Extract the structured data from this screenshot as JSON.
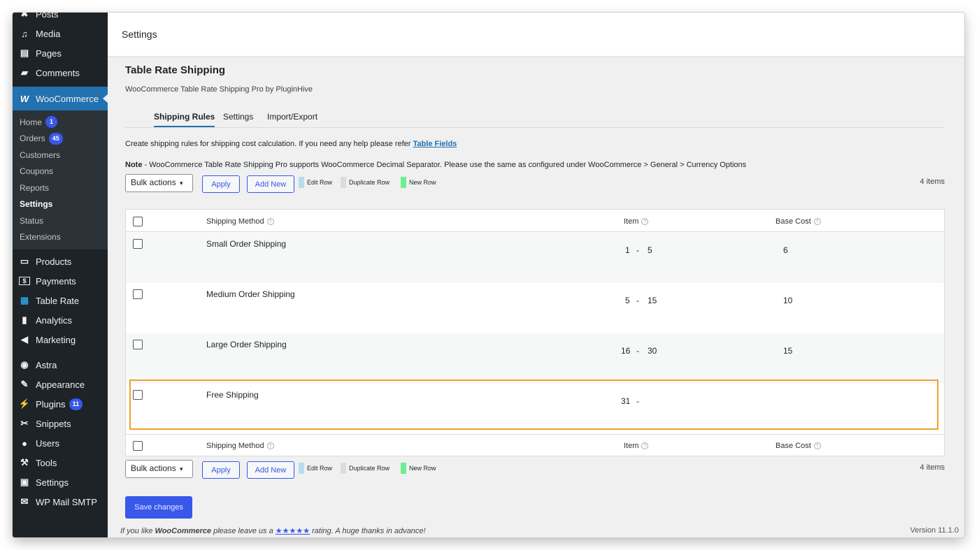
{
  "sidebar": {
    "items_top": [
      {
        "icon": "pushpin-icon",
        "glyph": "✖",
        "label": "Posts"
      },
      {
        "icon": "media-icon",
        "glyph": "♫",
        "label": "Media"
      },
      {
        "icon": "pages-icon",
        "glyph": "▤",
        "label": "Pages"
      },
      {
        "icon": "comments-icon",
        "glyph": "▰",
        "label": "Comments"
      }
    ],
    "woocommerce": {
      "icon": "woocommerce-icon",
      "glyph": "W",
      "label": "WooCommerce"
    },
    "submenu": [
      {
        "label": "Home",
        "badge": "1"
      },
      {
        "label": "Orders",
        "badge": "45"
      },
      {
        "label": "Customers"
      },
      {
        "label": "Coupons"
      },
      {
        "label": "Reports"
      },
      {
        "label": "Settings",
        "active": true
      },
      {
        "label": "Status"
      },
      {
        "label": "Extensions"
      }
    ],
    "items_mid": [
      {
        "icon": "products-icon",
        "glyph": "▭",
        "label": "Products"
      },
      {
        "icon": "payments-icon",
        "glyph": "$",
        "label": "Payments"
      },
      {
        "icon": "table-rate-icon",
        "glyph": "▦",
        "label": "Table Rate"
      },
      {
        "icon": "analytics-icon",
        "glyph": "▮",
        "label": "Analytics"
      },
      {
        "icon": "marketing-icon",
        "glyph": "◀",
        "label": "Marketing"
      }
    ],
    "items_bottom": [
      {
        "icon": "astra-icon",
        "glyph": "◉",
        "label": "Astra"
      },
      {
        "icon": "appearance-icon",
        "glyph": "✎",
        "label": "Appearance"
      },
      {
        "icon": "plugins-icon",
        "glyph": "⚡",
        "label": "Plugins",
        "badge": "11"
      },
      {
        "icon": "snippets-icon",
        "glyph": "✂",
        "label": "Snippets"
      },
      {
        "icon": "users-icon",
        "glyph": "●",
        "label": "Users"
      },
      {
        "icon": "tools-icon",
        "glyph": "⚒",
        "label": "Tools"
      },
      {
        "icon": "settings-icon",
        "glyph": "▣",
        "label": "Settings"
      },
      {
        "icon": "mail-icon",
        "glyph": "✉",
        "label": "WP Mail SMTP"
      }
    ]
  },
  "header": {
    "title": "Settings"
  },
  "page": {
    "title": "Table Rate Shipping",
    "subtitle": "WooCommerce Table Rate Shipping Pro by PluginHive",
    "tabs": [
      "Shipping Rules",
      "Settings",
      "Import/Export"
    ],
    "help_text": "Create shipping rules for shipping cost calculation. If you need any help please refer ",
    "help_link": "Table Fields",
    "note_label": "Note",
    "note_text": " - WooCommerce Table Rate Shipping Pro supports WooCommerce Decimal Separator. Please use the same as configured under WooCommerce > General > Currency Options"
  },
  "toolbar": {
    "bulk_actions": "Bulk actions",
    "apply": "Apply",
    "add_new": "Add New",
    "legend_edit": "Edit Row",
    "legend_duplicate": "Duplicate Row",
    "legend_new": "New Row",
    "items_count": "4 items",
    "colors": {
      "edit": "#b8dcec",
      "duplicate": "#dcdcde",
      "new": "#6eef8f"
    }
  },
  "table": {
    "columns": [
      "Shipping Method",
      "Item",
      "Base Cost"
    ],
    "rows": [
      {
        "method": "Small Order Shipping",
        "item_min": "1",
        "item_max": "5",
        "base_cost": "6"
      },
      {
        "method": "Medium Order Shipping",
        "item_min": "5",
        "item_max": "15",
        "base_cost": "10"
      },
      {
        "method": "Large Order Shipping",
        "item_min": "16",
        "item_max": "30",
        "base_cost": "15"
      },
      {
        "method": "Free Shipping",
        "item_min": "31",
        "item_max": "",
        "base_cost": ""
      }
    ],
    "highlight_color": "#f0a128"
  },
  "save_button": "Save changes",
  "footer": {
    "prefix": "If you like ",
    "brand": "WooCommerce",
    "middle": " please leave us a ",
    "stars": "★★★★★",
    "suffix": " rating. A huge thanks in advance!",
    "version": "Version 11.1.0"
  }
}
